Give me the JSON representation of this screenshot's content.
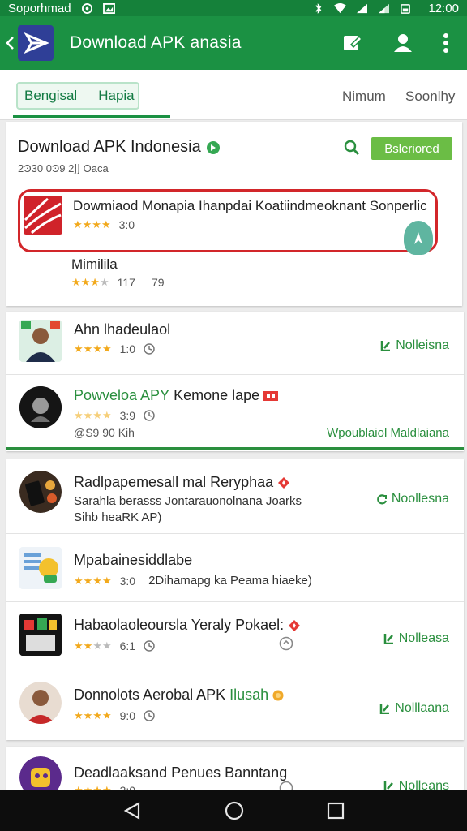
{
  "status_bar": {
    "left_text": "Soporhmad",
    "time": "12:00"
  },
  "app_bar": {
    "title": "Download APK anasia",
    "icons": [
      "back-arrow-icon",
      "edit-icon",
      "account-icon",
      "more-vert-icon"
    ]
  },
  "tabs": {
    "group": [
      "Bengisal",
      "Hapia"
    ],
    "right": [
      "Nimum",
      "Soonlhy"
    ]
  },
  "featured": {
    "heading": "Download APK Indonesia",
    "subheading": "2Ͽ30 0Ͽ9 2ͿͿ Oaca",
    "action_label": "Bsleriored",
    "highlight": {
      "text": "Dowmiaod Monapia Ihanpdai Koatiindmeoknant Sonperlic",
      "rating": "3:0"
    },
    "item2": {
      "name": "Mimilila",
      "rating": "117",
      "count": "79"
    }
  },
  "list1": [
    {
      "name": "Ahn lhadeulaol",
      "rating": "1:0",
      "action": "Nolleisna"
    },
    {
      "name_green": "Powveloa APY",
      "name_rest": "Kemone lape",
      "rating": "3:9",
      "size": "@S9 90 Kih",
      "action": "Wpoublaiol Maldlaiana"
    }
  ],
  "list2": [
    {
      "name": "Radlpapemesall mal Reryphaa",
      "desc1": "Sarahla berasss Jontarauonolnana Joarks",
      "desc2": "Sihb heaRK AP)",
      "action": "Noollesna"
    },
    {
      "name": "Mpabainesiddlabe",
      "rating": "3:0",
      "extra": "2Dihamapg ka Peama hiaeke)"
    },
    {
      "name": "Habaolaoleoursla Yeraly Pokael:",
      "rating": "6:1",
      "action": "Nolleasa"
    },
    {
      "name": "Donnolots Aerobal APK",
      "name_green": "Ilusah",
      "rating": "9:0",
      "action": "Nolllaana"
    },
    {
      "name": "Deadlaaksand Penues Banntang",
      "rating": "3:0",
      "action": "Nolleans"
    }
  ],
  "colors": {
    "primary": "#1b9143",
    "statusbar": "#15813a",
    "highlight_border": "#d2262a",
    "star": "#f2a91c"
  }
}
